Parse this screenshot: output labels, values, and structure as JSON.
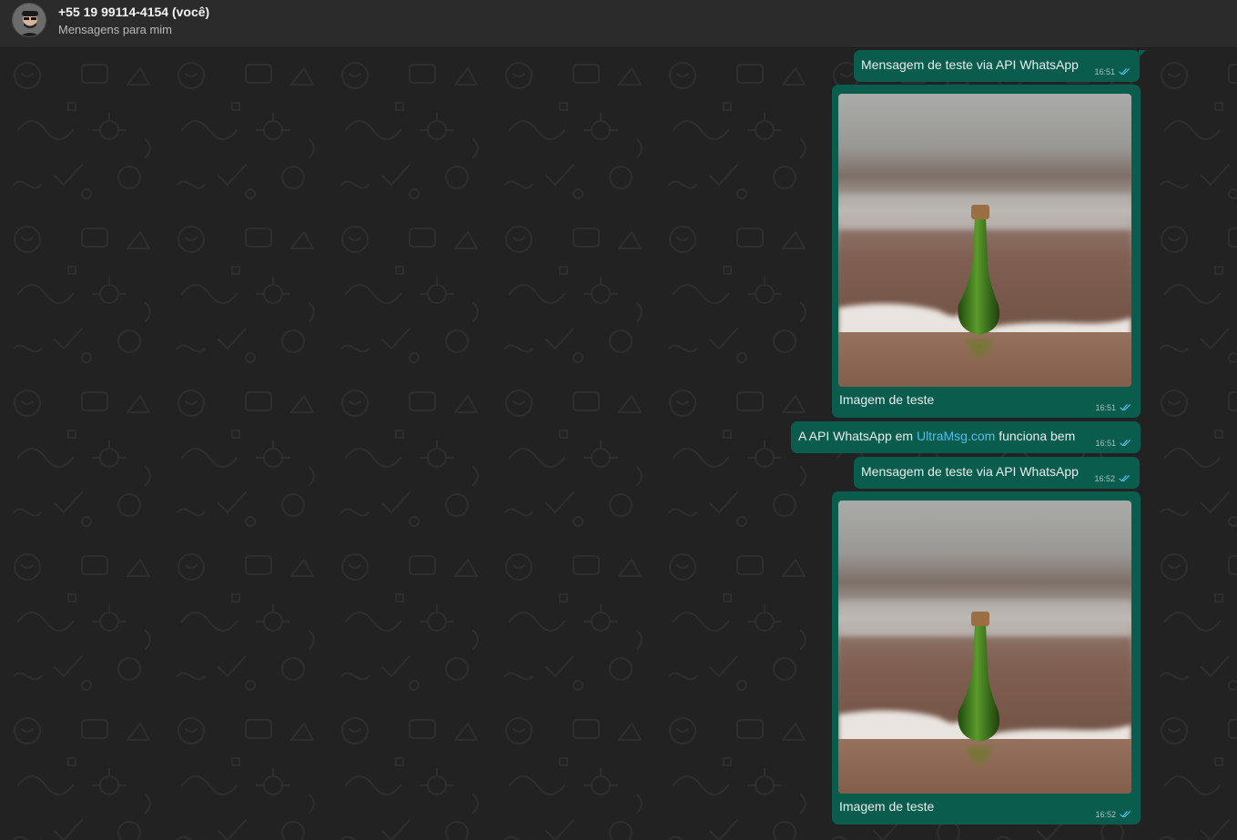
{
  "header": {
    "contact_name": "+55 19 99114-4154 (você)",
    "contact_subtitle": "Mensagens para mim",
    "avatar_icon": "avatar"
  },
  "colors": {
    "bubble_outgoing": "#0a5c4d",
    "link": "#53bdeb",
    "read_ticks": "#53bdeb",
    "background": "#222222"
  },
  "messages": [
    {
      "type": "text",
      "text": "Mensagem de teste via API WhatsApp",
      "time": "16:51",
      "status": "read"
    },
    {
      "type": "image",
      "caption": "Imagem de teste",
      "time": "16:51",
      "status": "read",
      "image": "bottle-on-beach"
    },
    {
      "type": "text",
      "text_before": "A API WhatsApp em ",
      "link": "UltraMsg.com",
      "text_after": " funciona bem",
      "time": "16:51",
      "status": "read"
    },
    {
      "type": "text",
      "text": "Mensagem de teste via API WhatsApp",
      "time": "16:52",
      "status": "read"
    },
    {
      "type": "image",
      "caption": "Imagem de teste",
      "time": "16:52",
      "status": "read",
      "image": "bottle-on-beach"
    }
  ]
}
